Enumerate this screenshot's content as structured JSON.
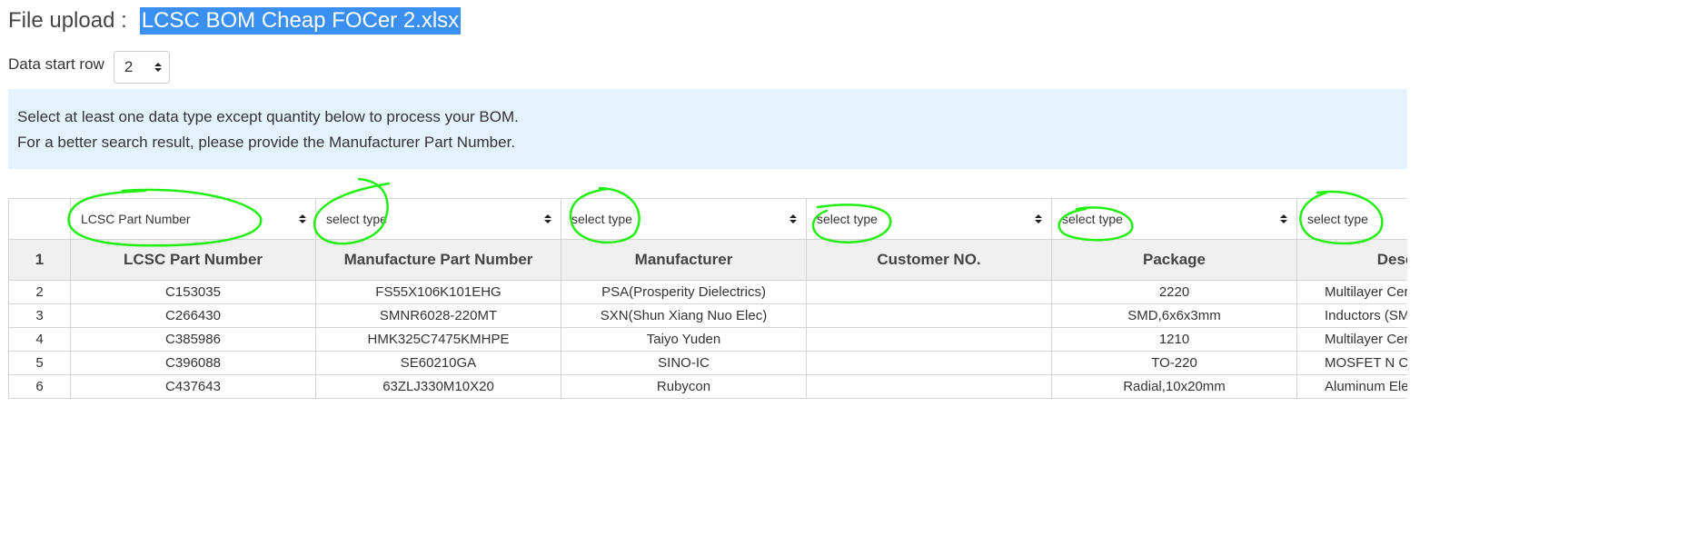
{
  "header": {
    "label": "File upload :",
    "file_name": "LCSC BOM Cheap FOCer 2.xlsx"
  },
  "start_row": {
    "label": "Data start row",
    "value": "2"
  },
  "info": {
    "line1": "Select at least one data type except quantity below to process your BOM.",
    "line2": "For a better search result, please provide the Manufacturer Part Number."
  },
  "type_selects": [
    "LCSC Part Number",
    "select type",
    "select type",
    "select type",
    "select type",
    "select type"
  ],
  "table": {
    "header_index": "1",
    "columns": [
      "LCSC Part Number",
      "Manufacture Part Number",
      "Manufacturer",
      "Customer NO.",
      "Package",
      "Description"
    ],
    "rows": [
      [
        "2",
        "C153035",
        "FS55X106K101EHG",
        "PSA(Prosperity Dielectrics)",
        "",
        "2220",
        "Multilayer Ceramic Capacitors MLCC - SMD/SMT"
      ],
      [
        "3",
        "C266430",
        "SMNR6028-220MT",
        "SXN(Shun Xiang Nuo Elec)",
        "",
        "SMD,6x6x3mm",
        "Inductors (SMD)"
      ],
      [
        "4",
        "C385986",
        "HMK325C7475KMHPE",
        "Taiyo Yuden",
        "",
        "1210",
        "Multilayer Ceramic Capacitors MLCC - SMD/SMT"
      ],
      [
        "5",
        "C396088",
        "SE60210GA",
        "SINO-IC",
        "",
        "TO-220",
        "MOSFET N Channel"
      ],
      [
        "6",
        "C437643",
        "63ZLJ330M10X20",
        "Rubycon",
        "",
        "Radial,10x20mm",
        "Aluminum Electrolytic Capacitors"
      ]
    ]
  },
  "annotation_color": "#22ee11"
}
